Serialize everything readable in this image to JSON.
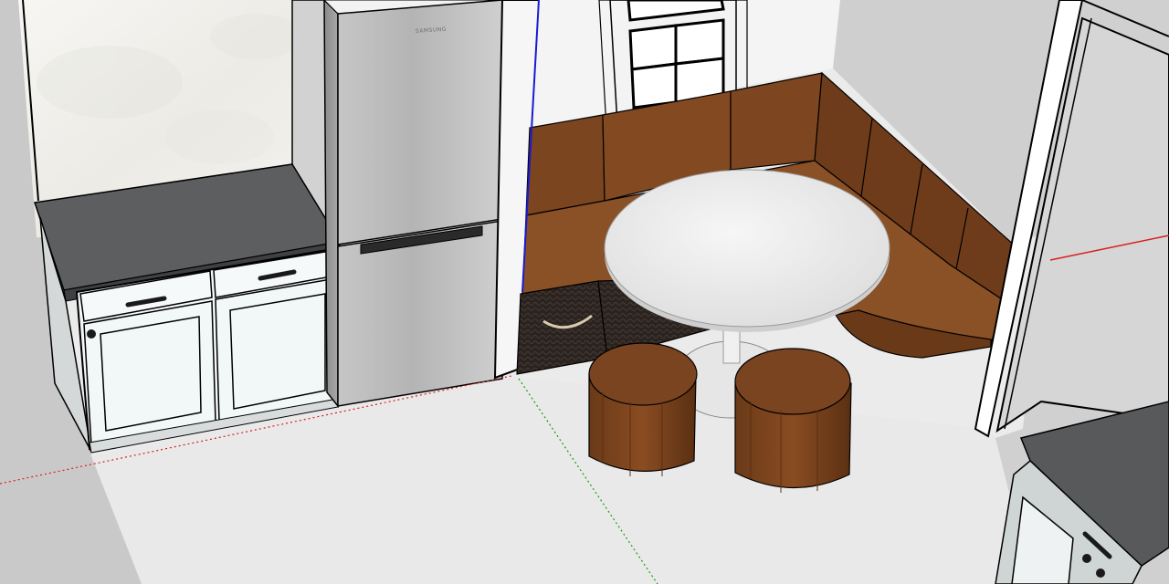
{
  "scene": {
    "kind": "3d-model-viewport",
    "objects": [
      {
        "name": "floor",
        "color": "#e9e9e9"
      },
      {
        "name": "left-wall",
        "color": "#c9c9c9"
      },
      {
        "name": "back-wall",
        "color": "#f4f4f4"
      },
      {
        "name": "right-wall",
        "color": "#cfcfcf"
      },
      {
        "name": "base-cabinets",
        "count": 2,
        "color": "#f3f7f7"
      },
      {
        "name": "countertop",
        "color": "#5d5e60"
      },
      {
        "name": "refrigerator",
        "color": "#b8b8b8"
      },
      {
        "name": "window",
        "panes": 8
      },
      {
        "name": "corner-banquette",
        "color": "#7b4520"
      },
      {
        "name": "round-pedestal-table",
        "color": "#ececec"
      },
      {
        "name": "storage-baskets",
        "count": 2,
        "color": "#2c2622"
      },
      {
        "name": "stools",
        "count": 2,
        "color": "#7a4420"
      },
      {
        "name": "doorway"
      },
      {
        "name": "right-cabinet-with-countertop"
      }
    ],
    "axes": {
      "red": "#d92020",
      "green": "#10a010",
      "blue": "#1b1bd0"
    },
    "fridge_logo_text": "SAMSUNG"
  }
}
